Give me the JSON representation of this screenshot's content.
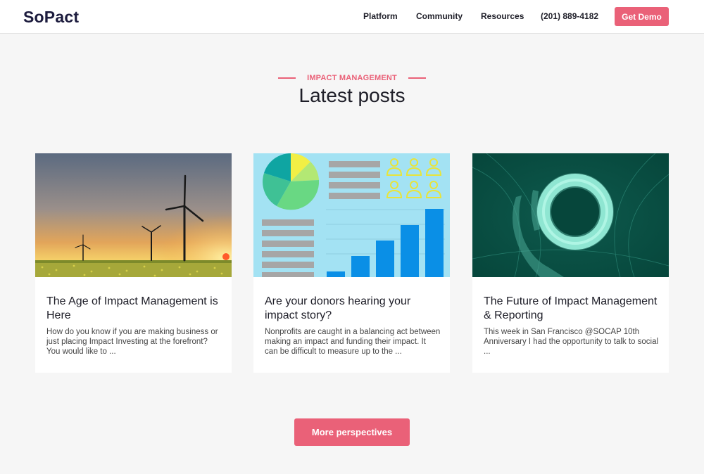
{
  "header": {
    "logo": "SoPact",
    "nav": {
      "platform": "Platform",
      "community": "Community",
      "resources": "Resources",
      "phone": "(201) 889-4182"
    },
    "cta": "Get Demo"
  },
  "section": {
    "eyebrow": "IMPACT MANAGEMENT",
    "title": "Latest posts"
  },
  "posts": [
    {
      "title": "The Age of Impact Management is Here",
      "excerpt": "  How do you know if you are making business or just placing Impact Investing at the forefront? You would like to ..."
    },
    {
      "title": "Are your donors hearing your impact story?",
      "excerpt": "Nonprofits are caught in a balancing act between making an impact and funding their impact. It can be difficult to measure up to the ..."
    },
    {
      "title": "The Future of Impact Management & Reporting",
      "excerpt": "This week in San Francisco @SOCAP 10th Anniversary I had the opportunity to talk to social ..."
    }
  ],
  "more_button": "More perspectives",
  "colors": {
    "accent": "#ea6178",
    "logo": "#1c1b3d",
    "text": "#1e1e28",
    "background": "#f6f6f6"
  },
  "icons": [
    "wind-turbine-photo",
    "infographic-illustration",
    "ring-hand-photo"
  ]
}
